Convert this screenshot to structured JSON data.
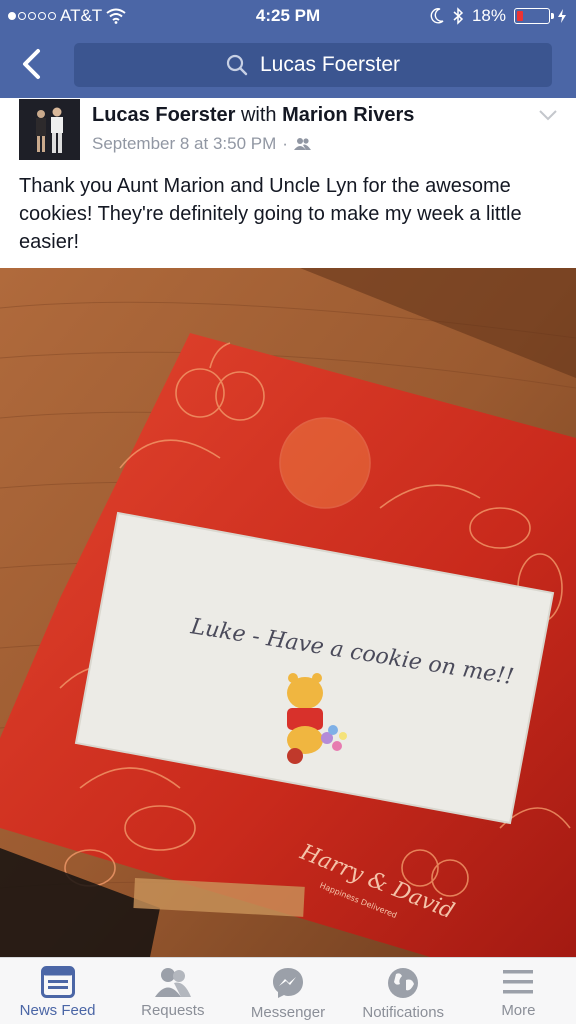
{
  "status": {
    "carrier": "AT&T",
    "time": "4:25 PM",
    "battery": "18%",
    "battery_level": 0.18
  },
  "header": {
    "search_text": "Lucas Foerster"
  },
  "post": {
    "author": "Lucas Foerster",
    "with_word": "with",
    "tagged": "Marion Rivers",
    "timestamp": "September 8 at 3:50 PM",
    "separator": "·",
    "text": "Thank you Aunt Marion and Uncle Lyn for the awesome cookies! They're definitely going to make my week a little easier!"
  },
  "photo": {
    "note_line1": "Luke - Have a cookie on me!!",
    "brand": "Harry & David",
    "brand_tagline": "Happiness Delivered"
  },
  "tabs": [
    {
      "label": "News Feed",
      "icon": "news-feed-icon"
    },
    {
      "label": "Requests",
      "icon": "friend-requests-icon"
    },
    {
      "label": "Messenger",
      "icon": "messenger-icon"
    },
    {
      "label": "Notifications",
      "icon": "globe-icon"
    },
    {
      "label": "More",
      "icon": "hamburger-icon"
    }
  ],
  "colors": {
    "header": "#4b66a6",
    "search": "#3b5590",
    "active_tab": "#4b66a6",
    "inactive_tab": "#8b8f98"
  }
}
